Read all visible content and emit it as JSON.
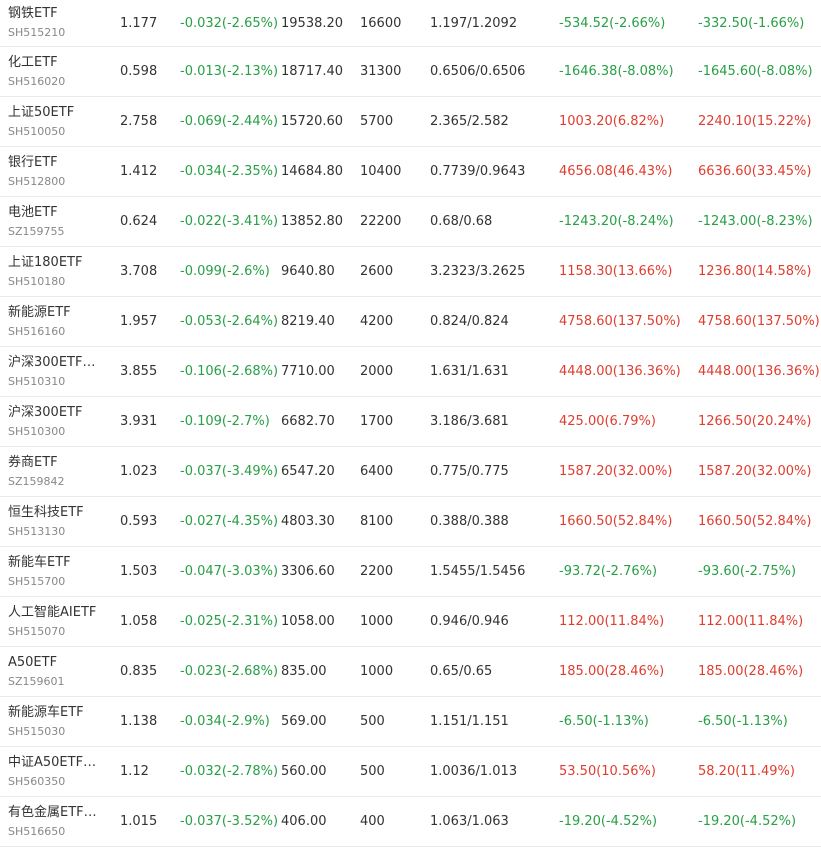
{
  "colors": {
    "gain": "#e13d2f",
    "loss": "#27a046",
    "text": "#333333",
    "subtext": "#888888",
    "divider": "#ebebeb"
  },
  "rows": [
    {
      "name": "钢铁ETF",
      "code": "SH515210",
      "price": "1.177",
      "change": "-0.032(-2.65%)",
      "change_dir": "down",
      "market_value": "19538.20",
      "quantity": "16600",
      "cost": "1.197/1.2092",
      "pl_1": "-534.52(-2.66%)",
      "pl_1_dir": "down",
      "pl_2": "-332.50(-1.66%)",
      "pl_2_dir": "down"
    },
    {
      "name": "化工ETF",
      "code": "SH516020",
      "price": "0.598",
      "change": "-0.013(-2.13%)",
      "change_dir": "down",
      "market_value": "18717.40",
      "quantity": "31300",
      "cost": "0.6506/0.6506",
      "pl_1": "-1646.38(-8.08%)",
      "pl_1_dir": "down",
      "pl_2": "-1645.60(-8.08%)",
      "pl_2_dir": "down"
    },
    {
      "name": "上证50ETF",
      "code": "SH510050",
      "price": "2.758",
      "change": "-0.069(-2.44%)",
      "change_dir": "down",
      "market_value": "15720.60",
      "quantity": "5700",
      "cost": "2.365/2.582",
      "pl_1": "1003.20(6.82%)",
      "pl_1_dir": "up",
      "pl_2": "2240.10(15.22%)",
      "pl_2_dir": "up"
    },
    {
      "name": "银行ETF",
      "code": "SH512800",
      "price": "1.412",
      "change": "-0.034(-2.35%)",
      "change_dir": "down",
      "market_value": "14684.80",
      "quantity": "10400",
      "cost": "0.7739/0.9643",
      "pl_1": "4656.08(46.43%)",
      "pl_1_dir": "up",
      "pl_2": "6636.60(33.45%)",
      "pl_2_dir": "up"
    },
    {
      "name": "电池ETF",
      "code": "SZ159755",
      "price": "0.624",
      "change": "-0.022(-3.41%)",
      "change_dir": "down",
      "market_value": "13852.80",
      "quantity": "22200",
      "cost": "0.68/0.68",
      "pl_1": "-1243.20(-8.24%)",
      "pl_1_dir": "down",
      "pl_2": "-1243.00(-8.23%)",
      "pl_2_dir": "down"
    },
    {
      "name": "上证180ETF",
      "code": "SH510180",
      "price": "3.708",
      "change": "-0.099(-2.6%)",
      "change_dir": "down",
      "market_value": "9640.80",
      "quantity": "2600",
      "cost": "3.2323/3.2625",
      "pl_1": "1158.30(13.66%)",
      "pl_1_dir": "up",
      "pl_2": "1236.80(14.58%)",
      "pl_2_dir": "up"
    },
    {
      "name": "新能源ETF",
      "code": "SH516160",
      "price": "1.957",
      "change": "-0.053(-2.64%)",
      "change_dir": "down",
      "market_value": "8219.40",
      "quantity": "4200",
      "cost": "0.824/0.824",
      "pl_1": "4758.60(137.50%)",
      "pl_1_dir": "up",
      "pl_2": "4758.60(137.50%)",
      "pl_2_dir": "up"
    },
    {
      "name": "沪深300ETF…",
      "code": "SH510310",
      "price": "3.855",
      "change": "-0.106(-2.68%)",
      "change_dir": "down",
      "market_value": "7710.00",
      "quantity": "2000",
      "cost": "1.631/1.631",
      "pl_1": "4448.00(136.36%)",
      "pl_1_dir": "up",
      "pl_2": "4448.00(136.36%)",
      "pl_2_dir": "up"
    },
    {
      "name": "沪深300ETF",
      "code": "SH510300",
      "price": "3.931",
      "change": "-0.109(-2.7%)",
      "change_dir": "down",
      "market_value": "6682.70",
      "quantity": "1700",
      "cost": "3.186/3.681",
      "pl_1": "425.00(6.79%)",
      "pl_1_dir": "up",
      "pl_2": "1266.50(20.24%)",
      "pl_2_dir": "up"
    },
    {
      "name": "券商ETF",
      "code": "SZ159842",
      "price": "1.023",
      "change": "-0.037(-3.49%)",
      "change_dir": "down",
      "market_value": "6547.20",
      "quantity": "6400",
      "cost": "0.775/0.775",
      "pl_1": "1587.20(32.00%)",
      "pl_1_dir": "up",
      "pl_2": "1587.20(32.00%)",
      "pl_2_dir": "up"
    },
    {
      "name": "恒生科技ETF",
      "code": "SH513130",
      "price": "0.593",
      "change": "-0.027(-4.35%)",
      "change_dir": "down",
      "market_value": "4803.30",
      "quantity": "8100",
      "cost": "0.388/0.388",
      "pl_1": "1660.50(52.84%)",
      "pl_1_dir": "up",
      "pl_2": "1660.50(52.84%)",
      "pl_2_dir": "up"
    },
    {
      "name": "新能车ETF",
      "code": "SH515700",
      "price": "1.503",
      "change": "-0.047(-3.03%)",
      "change_dir": "down",
      "market_value": "3306.60",
      "quantity": "2200",
      "cost": "1.5455/1.5456",
      "pl_1": "-93.72(-2.76%)",
      "pl_1_dir": "down",
      "pl_2": "-93.60(-2.75%)",
      "pl_2_dir": "down"
    },
    {
      "name": "人工智能AIETF",
      "code": "SH515070",
      "price": "1.058",
      "change": "-0.025(-2.31%)",
      "change_dir": "down",
      "market_value": "1058.00",
      "quantity": "1000",
      "cost": "0.946/0.946",
      "pl_1": "112.00(11.84%)",
      "pl_1_dir": "up",
      "pl_2": "112.00(11.84%)",
      "pl_2_dir": "up"
    },
    {
      "name": "A50ETF",
      "code": "SZ159601",
      "price": "0.835",
      "change": "-0.023(-2.68%)",
      "change_dir": "down",
      "market_value": "835.00",
      "quantity": "1000",
      "cost": "0.65/0.65",
      "pl_1": "185.00(28.46%)",
      "pl_1_dir": "up",
      "pl_2": "185.00(28.46%)",
      "pl_2_dir": "up"
    },
    {
      "name": "新能源车ETF",
      "code": "SH515030",
      "price": "1.138",
      "change": "-0.034(-2.9%)",
      "change_dir": "down",
      "market_value": "569.00",
      "quantity": "500",
      "cost": "1.151/1.151",
      "pl_1": "-6.50(-1.13%)",
      "pl_1_dir": "down",
      "pl_2": "-6.50(-1.13%)",
      "pl_2_dir": "down"
    },
    {
      "name": "中证A50ETF…",
      "code": "SH560350",
      "price": "1.12",
      "change": "-0.032(-2.78%)",
      "change_dir": "down",
      "market_value": "560.00",
      "quantity": "500",
      "cost": "1.0036/1.013",
      "pl_1": "53.50(10.56%)",
      "pl_1_dir": "up",
      "pl_2": "58.20(11.49%)",
      "pl_2_dir": "up"
    },
    {
      "name": "有色金属ETF…",
      "code": "SH516650",
      "price": "1.015",
      "change": "-0.037(-3.52%)",
      "change_dir": "down",
      "market_value": "406.00",
      "quantity": "400",
      "cost": "1.063/1.063",
      "pl_1": "-19.20(-4.52%)",
      "pl_1_dir": "down",
      "pl_2": "-19.20(-4.52%)",
      "pl_2_dir": "down"
    }
  ]
}
